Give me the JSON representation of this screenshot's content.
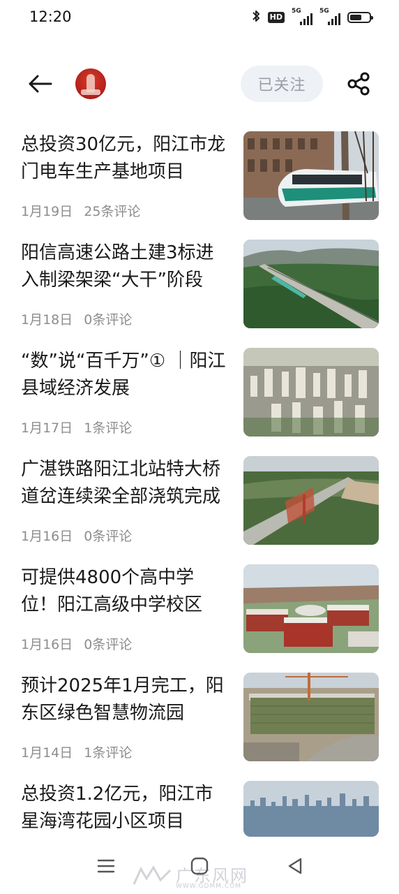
{
  "status_bar": {
    "time": "12:20",
    "hd_badge": "HD",
    "signal_labels": [
      "5G",
      "5G"
    ],
    "battery_level": 0.6
  },
  "header": {
    "follow_label": "已关注"
  },
  "articles": [
    {
      "title": "总投资30亿元，阳江市龙门电车生产基地项目",
      "date": "1月19日",
      "comments": "25条评论"
    },
    {
      "title": "阳信高速公路土建3标进入制梁架梁“大干”阶段",
      "date": "1月18日",
      "comments": "0条评论"
    },
    {
      "title": "“数”说“百千万”① ｜阳江县域经济发展",
      "date": "1月17日",
      "comments": "1条评论"
    },
    {
      "title": "广湛铁路阳江北站特大桥道岔连续梁全部浇筑完成",
      "date": "1月16日",
      "comments": "0条评论"
    },
    {
      "title": "可提供4800个高中学位！阳江高级中学校区",
      "date": "1月16日",
      "comments": "0条评论"
    },
    {
      "title": "预计2025年1月完工，阳东区绿色智慧物流园",
      "date": "1月14日",
      "comments": "1条评论"
    },
    {
      "title": "总投资1.2亿元，阳江市星海湾花园小区项目",
      "date": "",
      "comments": ""
    }
  ],
  "watermark": {
    "text": "广东风网",
    "url": "WWW.GDMM.COM"
  },
  "colors": {
    "follow_bg": "#eef1f5",
    "follow_text": "#9a9ea5",
    "meta_text": "#8d8d8d",
    "avatar_red": "#c1271d"
  },
  "icons": [
    "back-arrow-icon",
    "share-icon",
    "bluetooth-icon",
    "menu-icon",
    "home-icon",
    "nav-back-icon"
  ]
}
